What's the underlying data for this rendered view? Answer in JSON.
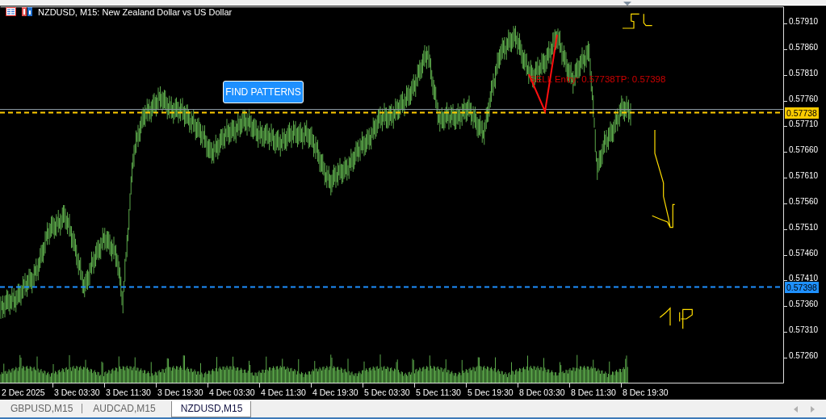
{
  "window": {
    "title": "NZDUSD, M15:  New Zealand Dollar vs US Dollar"
  },
  "chart": {
    "button": "FIND PATTERNS",
    "signal": "SELL Entry: 0.57738TP: 0.57398",
    "price_axis": [
      "0.57910",
      "0.57860",
      "0.57810",
      "0.57760",
      "0.57710",
      "0.57660",
      "0.57610",
      "0.57560",
      "0.57510",
      "0.57460",
      "0.57410",
      "0.57360",
      "0.57310",
      "0.57260"
    ],
    "time_axis": [
      "2 Dec 2025",
      "3 Dec 03:30",
      "3 Dec 11:30",
      "3 Dec 19:30",
      "4 Dec 03:30",
      "4 Dec 11:30",
      "4 Dec 19:30",
      "5 Dec 03:30",
      "5 Dec 11:30",
      "5 Dec 19:30",
      "8 Dec 03:30",
      "8 Dec 11:30",
      "8 Dec 19:30"
    ],
    "levels": [
      {
        "price": "0.57738",
        "color": "#ffcc00"
      },
      {
        "price": "0.57398",
        "color": "#1e90ff"
      }
    ]
  },
  "tabs": [
    {
      "label": "GBPUSD,M15",
      "selected": false
    },
    {
      "label": "AUDCAD,M15",
      "selected": false
    },
    {
      "label": "NZDUSD,M15",
      "selected": true
    }
  ]
}
